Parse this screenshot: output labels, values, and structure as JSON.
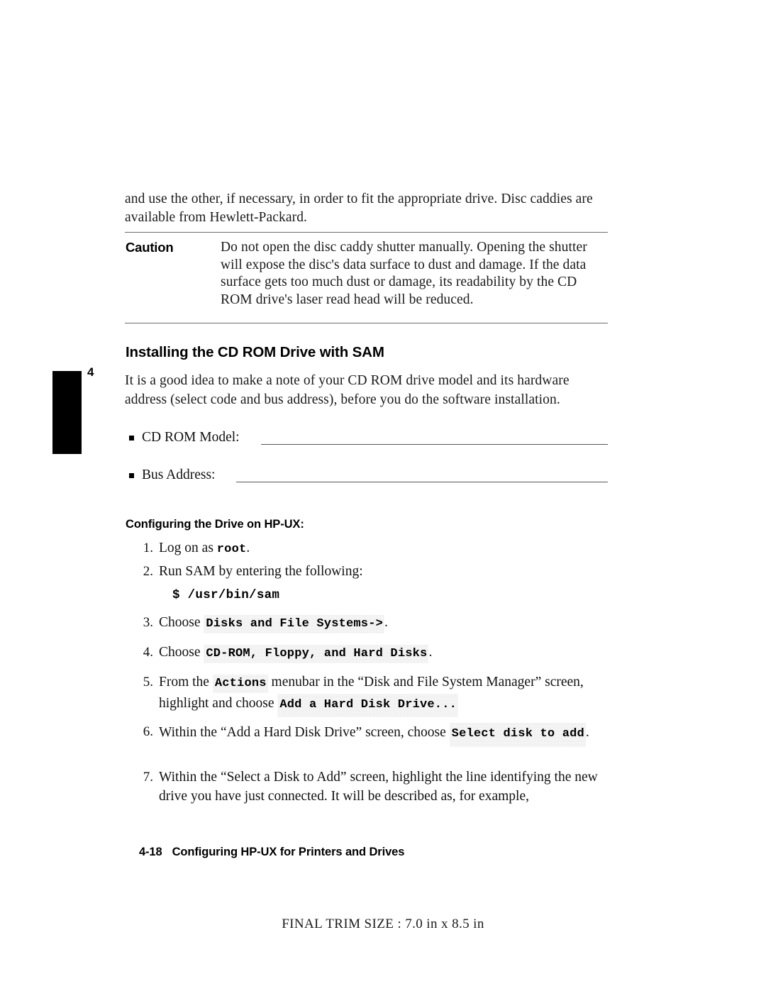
{
  "document": {
    "intro_paragraph": "and use the other, if necessary, in order to fit the appropriate drive. Disc caddies are available from Hewlett-Packard.",
    "chapter_number": "4"
  },
  "caution": {
    "label": "Caution",
    "text": "Do not open the disc caddy shutter manually. Opening the shutter will expose the disc's data surface to dust and damage. If the data surface gets too much dust or damage, its readability by the CD ROM drive's laser read head will be reduced."
  },
  "section": {
    "heading": "Installing the CD ROM Drive with SAM",
    "paragraph": "It is a good idea to make a note of your CD ROM drive model and its hardware address (select code and bus address), before you do the software installation.",
    "fill_ins": [
      {
        "label": "CD ROM Model:",
        "value": ""
      },
      {
        "label": "Bus Address:",
        "value": ""
      }
    ]
  },
  "subsection": {
    "heading": "Configuring the Drive on HP-UX:",
    "steps": [
      {
        "number": "1.",
        "pre": "Log on as ",
        "mono": "root",
        "post": "."
      },
      {
        "number": "2.",
        "pre": "Run SAM by entering the following:",
        "mono": "",
        "post": ""
      },
      {
        "number": "3.",
        "pre": "Choose ",
        "ui": "Disks and File Systems->",
        "post": "."
      },
      {
        "number": "4.",
        "pre": "Choose ",
        "ui": "CD-ROM, Floppy, and Hard Disks",
        "post": "."
      },
      {
        "number": "5.",
        "pre": "From the ",
        "ui": "Actions",
        "mid": " menubar in the “Disk and File System Manager” screen, highlight and choose ",
        "ui2": "Add a Hard Disk Drive...",
        "post": ""
      },
      {
        "number": "6.",
        "pre": "Within the “Add a Hard Disk Drive” screen, choose ",
        "ui": "Select disk to add",
        "post": "."
      },
      {
        "number": "7.",
        "pre": "Within the “Select a Disk to Add” screen, highlight the line identifying the new drive you have just connected. It will be described as, for example,",
        "post": ""
      }
    ],
    "command_line": "$ /usr/bin/sam"
  },
  "footer": {
    "page_number": "4-18",
    "title": "Configuring HP-UX for Printers and Drives"
  },
  "trim_note": "FINAL TRIM SIZE : 7.0 in x 8.5 in"
}
